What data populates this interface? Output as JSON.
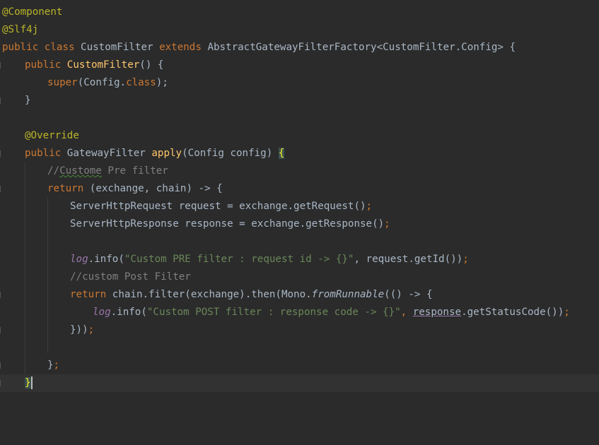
{
  "editor": {
    "lines": {
      "l1": {
        "ann": "@Component"
      },
      "l2": {
        "ann": "@Slf4j"
      },
      "l3": {
        "kw1": "public class ",
        "name": "CustomFilter ",
        "kw2": "extends ",
        "rest": "AbstractGatewayFilterFactory<CustomFilter.Config> {"
      },
      "l4": {
        "kw": "public ",
        "fn": "CustomFilter",
        "rest": "() {"
      },
      "l5": {
        "kw": "super",
        "mid": "(Config.",
        "kw2": "class",
        "end": ");",
        "semi": ""
      },
      "l6": {
        "text": "}"
      },
      "l8": {
        "ann": "@Override"
      },
      "l9": {
        "kw": "public ",
        "type": "GatewayFilter ",
        "fn": "apply",
        "rest": "(Config config) ",
        "brace": "{"
      },
      "l10": {
        "prefix": "//",
        "typo": "Custome",
        "rest": " Pre filter"
      },
      "l11": {
        "kw": "return ",
        "rest": "(exchange, chain) -> {"
      },
      "l12": {
        "text": "ServerHttpRequest request = exchange.getRequest()",
        "semi": ";"
      },
      "l13": {
        "text": "ServerHttpResponse response = exchange.getResponse()",
        "semi": ";"
      },
      "l15": {
        "field": "log",
        "mid": ".info(",
        "str": "\"Custom PRE filter : request id -> {}\"",
        "rest": ", request.getId())",
        "semi": ";"
      },
      "l16": {
        "text": "//custom Post Filter"
      },
      "l17": {
        "kw": "return ",
        "mid": "chain.filter(exchange).then(Mono.",
        "static": "fromRunnable",
        "rest": "(() -> {"
      },
      "l18": {
        "field": "log",
        "mid": ".info(",
        "str": "\"Custom POST filter : response code -> {}\"",
        "comma": ", ",
        "ul": "response",
        "rest": ".getStatusCode())",
        "semi": ";"
      },
      "l19": {
        "text": "}))",
        "semi": ";"
      },
      "l21": {
        "text": "}",
        "semi": ";"
      },
      "l22": {
        "text": "}"
      }
    }
  }
}
